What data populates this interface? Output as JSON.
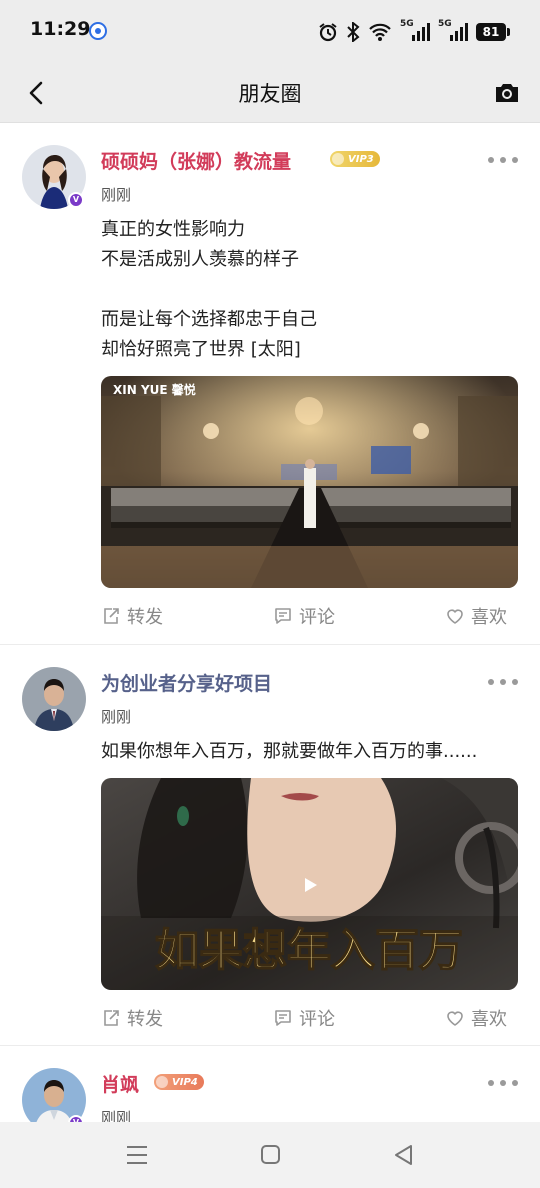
{
  "status_bar": {
    "time": "11:29",
    "signal1_label": "5G",
    "signal2_label": "5G",
    "battery": "81"
  },
  "header": {
    "title": "朋友圈"
  },
  "posts": [
    {
      "name": "硕硕妈（张娜）教流量",
      "vip": "VIP3",
      "time": "刚刚",
      "lines": [
        "真正的女性影响力",
        "不是活成别人羡慕的样子",
        "",
        "而是让每个选择都忠于自己",
        "却恰好照亮了世界 [太阳]"
      ],
      "image_logo": "XIN YUE 馨悦",
      "actions": {
        "share": "转发",
        "comment": "评论",
        "like": "喜欢"
      }
    },
    {
      "name": "为创业者分享好项目",
      "time": "刚刚",
      "lines": [
        "如果你想年入百万，那就要做年入百万的事......"
      ],
      "video_caption": "如果想年入百万",
      "actions": {
        "share": "转发",
        "comment": "评论",
        "like": "喜欢"
      }
    },
    {
      "name": "肖飒",
      "vip": "VIP4",
      "time": "刚刚"
    }
  ],
  "colors": {
    "name_red": "#d23c5a",
    "name_blue": "#56618a",
    "header_bg": "#ededed",
    "vip_gold": "#e6b83a",
    "vip_orange": "#e87a5a"
  },
  "icons": [
    "back-icon",
    "camera-icon",
    "more-icon",
    "share-icon",
    "comment-icon",
    "heart-icon",
    "play-icon",
    "alarm-icon",
    "bluetooth-icon",
    "wifi-icon",
    "menu-icon",
    "home-icon",
    "back-triangle-icon"
  ]
}
